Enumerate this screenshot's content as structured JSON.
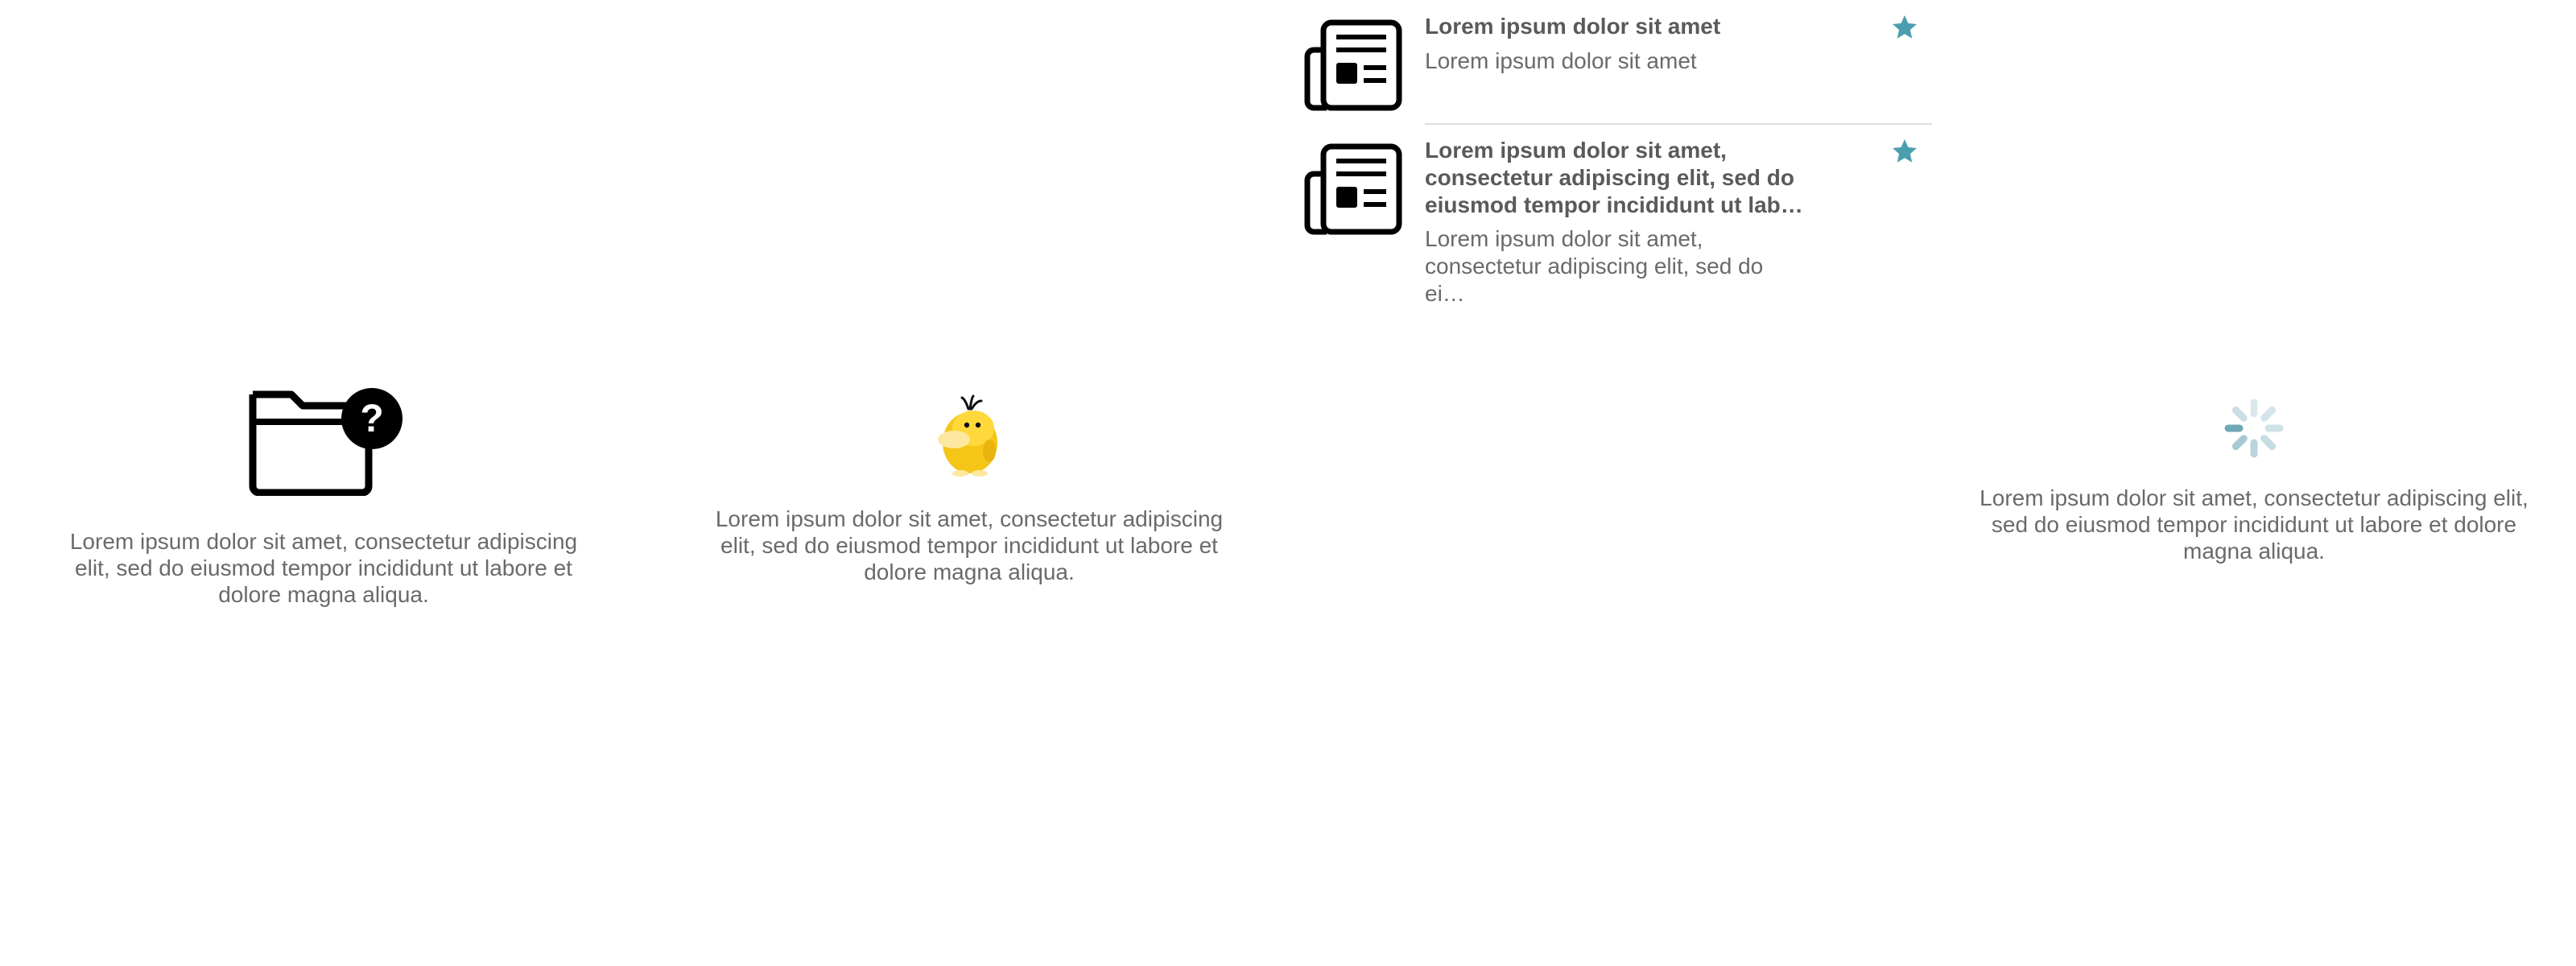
{
  "accent_color": "#4a9fae",
  "news": {
    "items": [
      {
        "icon": "newspaper-icon",
        "title": "Lorem ipsum dolor sit amet",
        "subtitle": "Lorem ipsum dolor sit amet",
        "favorite_icon": "star-icon",
        "favorited": true
      },
      {
        "icon": "newspaper-icon",
        "title": "Lorem ipsum dolor sit amet, consectetur adipiscing elit, sed do eiusmod tempor incididunt ut lab…",
        "subtitle": "Lorem ipsum dolor sit amet, consectetur adipiscing elit, sed do ei…",
        "favorite_icon": "star-icon",
        "favorited": true
      }
    ]
  },
  "panels": {
    "not_found": {
      "icon": "folder-question-icon",
      "text": "Lorem ipsum dolor sit amet, consectetur adipiscing elit, sed do eiusmod tempor incididunt ut labore et dolore magna aliqua."
    },
    "mascot": {
      "icon": "yellow-duck-mascot-icon",
      "text": "Lorem ipsum dolor sit amet, consectetur adipiscing elit, sed do eiusmod tempor incididunt ut labore et dolore magna aliqua."
    },
    "loading": {
      "icon": "loading-spinner-icon",
      "text": "Lorem ipsum dolor sit amet, consectetur adipiscing elit, sed do eiusmod tempor incididunt ut labore et dolore magna aliqua."
    }
  }
}
